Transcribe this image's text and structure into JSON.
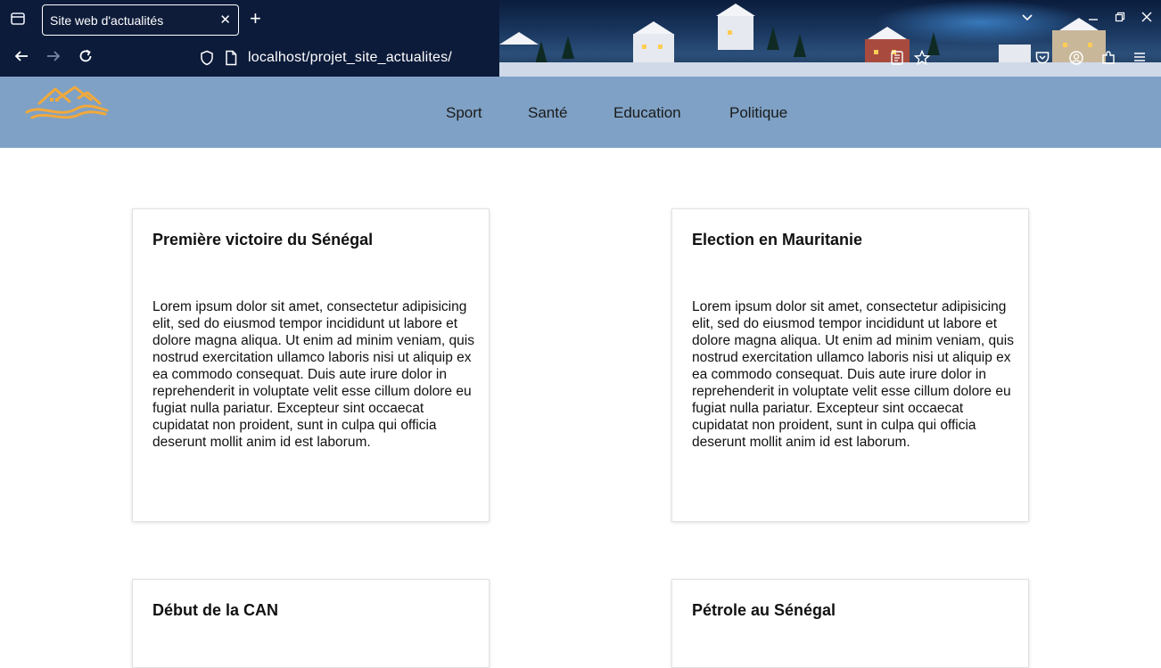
{
  "browser": {
    "tab_title": "Site web d'actualités",
    "url": "localhost/projet_site_actualites/"
  },
  "site": {
    "menu": [
      "Sport",
      "Santé",
      "Education",
      "Politique"
    ]
  },
  "articles": [
    {
      "title": "Première victoire du Sénégal",
      "body": "Lorem ipsum dolor sit amet, consectetur adipisicing elit, sed do eiusmod tempor incididunt ut labore et dolore magna aliqua. Ut enim ad minim veniam, quis nostrud exercitation ullamco laboris nisi ut aliquip ex ea commodo consequat. Duis aute irure dolor in reprehenderit in voluptate velit esse cillum dolore eu fugiat nulla pariatur. Excepteur sint occaecat cupidatat non proident, sunt in culpa qui officia deserunt mollit anim id est laborum."
    },
    {
      "title": "Election en Mauritanie",
      "body": "Lorem ipsum dolor sit amet, consectetur adipisicing elit, sed do eiusmod tempor incididunt ut labore et dolore magna aliqua. Ut enim ad minim veniam, quis nostrud exercitation ullamco laboris nisi ut aliquip ex ea commodo consequat. Duis aute irure dolor in reprehenderit in voluptate velit esse cillum dolore eu fugiat nulla pariatur. Excepteur sint occaecat cupidatat non proident, sunt in culpa qui officia deserunt mollit anim id est laborum."
    },
    {
      "title": "Début de la CAN"
    },
    {
      "title": "Pétrole au Sénégal"
    }
  ],
  "colors": {
    "header_bg": "#7fa1c5",
    "logo": "#f2a93b",
    "chrome_bg": "#0c1b3a"
  },
  "icons": {
    "tab_overview": "tab-list-icon",
    "close": "close-icon",
    "new_tab": "plus-icon",
    "back": "back-arrow-icon",
    "forward": "forward-arrow-icon",
    "reload": "reload-icon",
    "shield": "tracking-protection-shield-icon",
    "page": "page-info-icon",
    "reader": "reader-view-icon",
    "bookmark": "bookmark-star-icon",
    "pocket": "pocket-icon",
    "account": "account-icon",
    "extensions": "extensions-icon",
    "menu": "hamburger-menu-icon"
  }
}
